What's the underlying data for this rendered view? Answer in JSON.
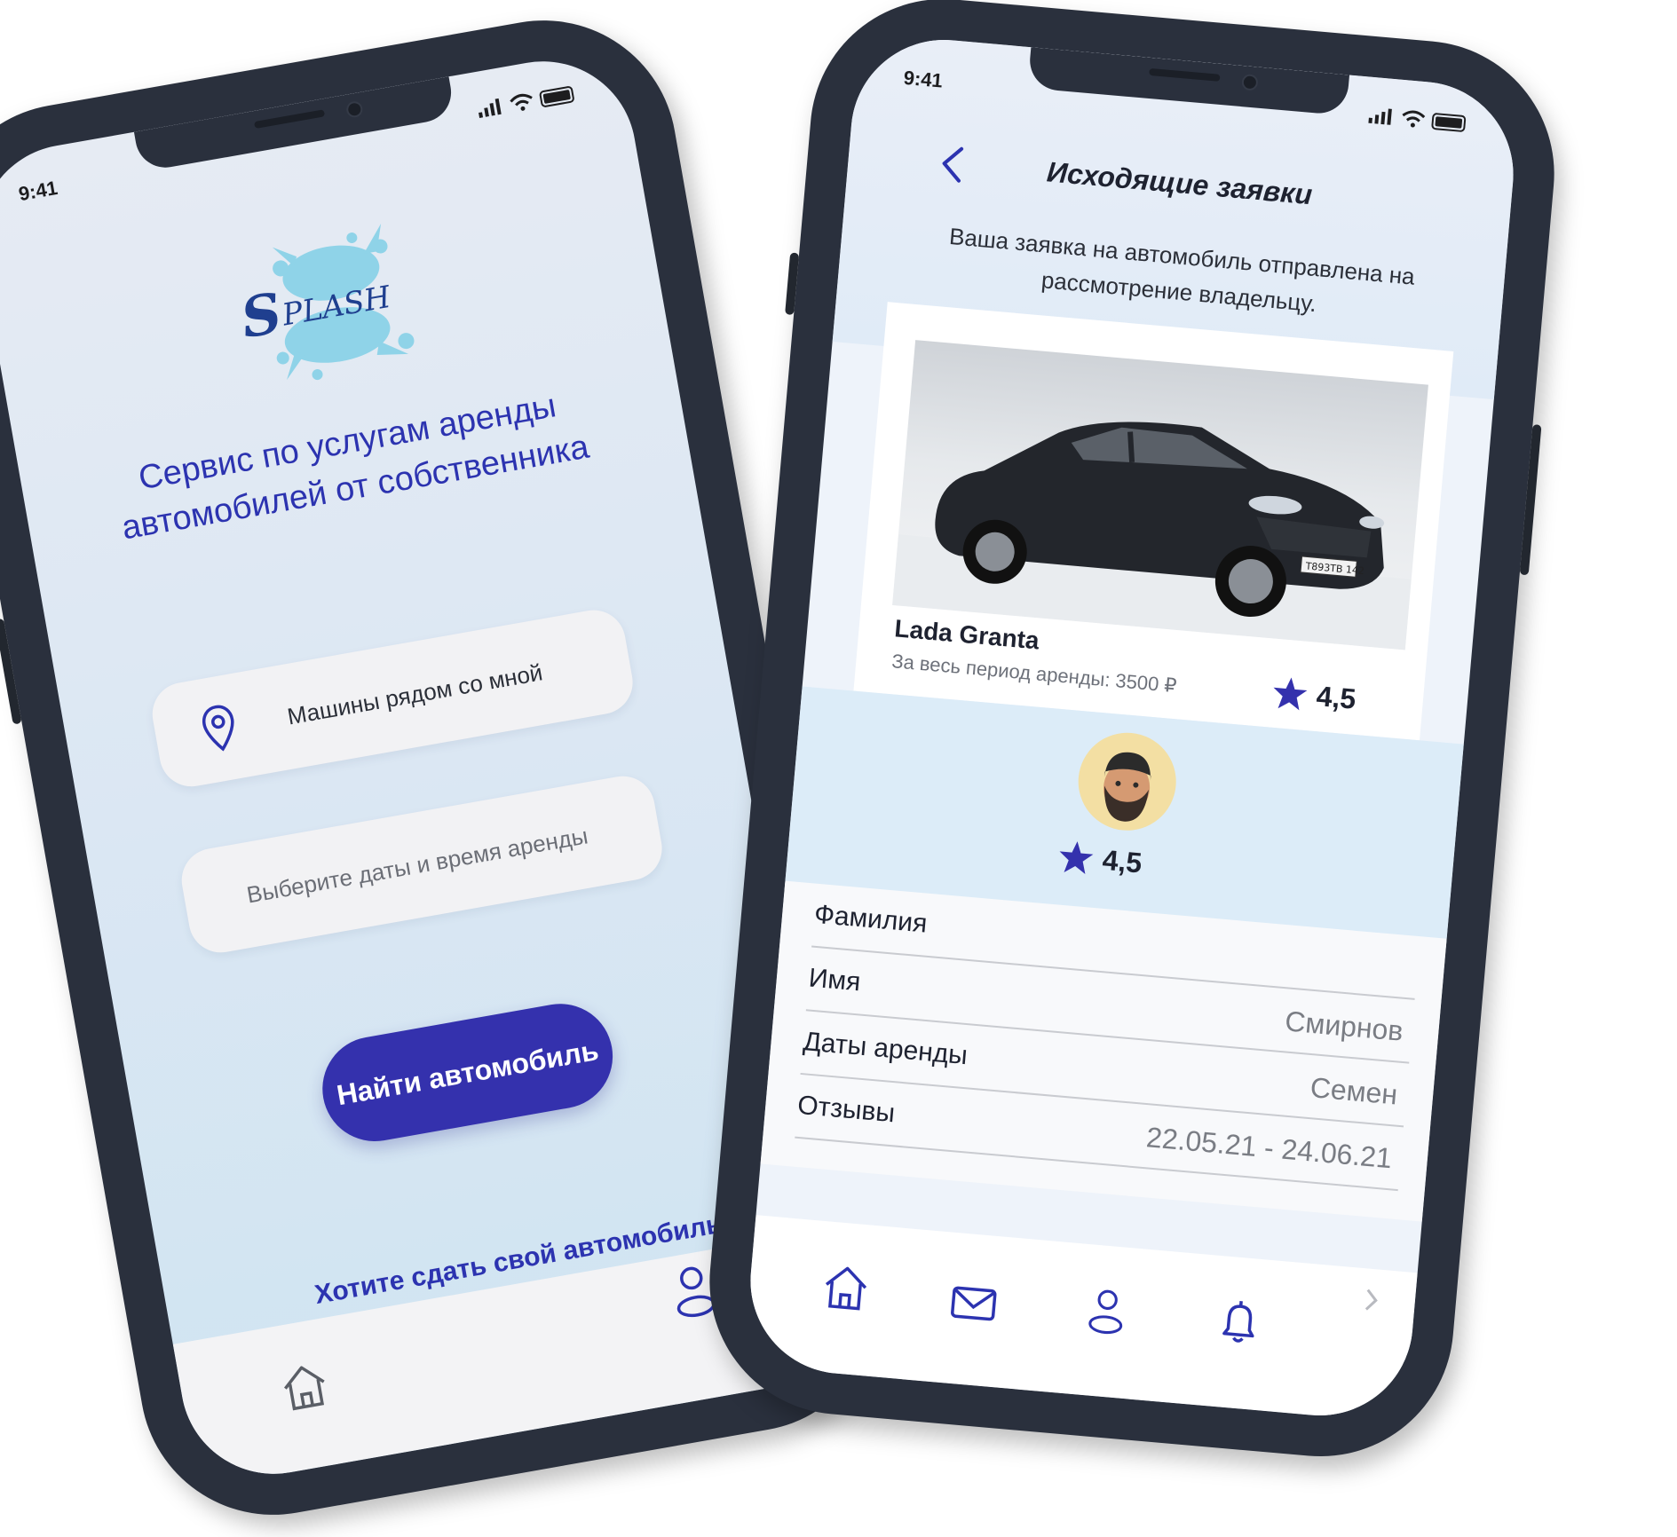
{
  "colors": {
    "accent": "#3431ad",
    "link": "#2c33b0",
    "phone_frame": "#2a303d",
    "text_dark": "#1e2230",
    "text_muted": "#7a7d84"
  },
  "left_phone": {
    "status": {
      "time": "9:41"
    },
    "logo_text": "SPLASH",
    "title": "Сервис по услугам аренды автомобилей от собственника",
    "nearby_field": {
      "icon": "location-pin-icon",
      "label": "Машины рядом со мной"
    },
    "dates_field": {
      "placeholder": "Выберите даты и время аренды"
    },
    "find_button": "Найти автомобиль",
    "rent_out_link": "Хотите сдать свой автомобиль",
    "tabbar": [
      {
        "icon": "home-icon"
      },
      {
        "icon": "profile-icon"
      }
    ]
  },
  "right_phone": {
    "status": {
      "time": "9:41"
    },
    "header": {
      "back_icon": "chevron-left-icon",
      "title": "Исходящие заявки",
      "subtitle": "Ваша заявка на автомобиль отправлена на рассмотрение владельцу."
    },
    "car": {
      "name": "Lada Granta",
      "price": "За весь период аренды: 3500 ₽",
      "rating": "4,5",
      "plate": "Т893ТВ 142"
    },
    "owner": {
      "rating": "4,5"
    },
    "details": [
      {
        "label": "Фамилия",
        "value": ""
      },
      {
        "label": "Имя",
        "value": "Смирнов"
      },
      {
        "label": "Даты аренды",
        "value": "Семен"
      },
      {
        "label": "Отзывы",
        "value": "22.05.21 - 24.06.21"
      }
    ],
    "tabbar": [
      {
        "icon": "home-icon"
      },
      {
        "icon": "mail-icon"
      },
      {
        "icon": "profile-icon"
      },
      {
        "icon": "bell-icon"
      }
    ]
  }
}
